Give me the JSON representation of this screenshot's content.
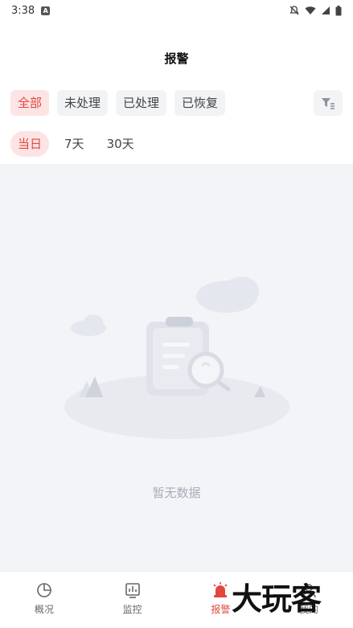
{
  "status_bar": {
    "time": "3:38"
  },
  "header": {
    "title": "报警"
  },
  "status_filters": [
    {
      "label": "全部",
      "active": true
    },
    {
      "label": "未处理",
      "active": false
    },
    {
      "label": "已处理",
      "active": false
    },
    {
      "label": "已恢复",
      "active": false
    }
  ],
  "date_ranges": [
    {
      "label": "当日",
      "active": true
    },
    {
      "label": "7天",
      "active": false
    },
    {
      "label": "30天",
      "active": false
    }
  ],
  "empty_state": {
    "text": "暂无数据"
  },
  "tabs": [
    {
      "label": "概况",
      "icon": "pie-chart-icon",
      "active": false
    },
    {
      "label": "监控",
      "icon": "monitor-icon",
      "active": false
    },
    {
      "label": "报警",
      "icon": "alarm-icon",
      "active": true
    },
    {
      "label": "我的",
      "icon": "user-icon",
      "active": false
    }
  ],
  "watermark": {
    "text": "大玩客"
  },
  "colors": {
    "accent": "#e2473f",
    "accent_bg": "#fde4e4",
    "content_bg": "#f3f4f8"
  }
}
